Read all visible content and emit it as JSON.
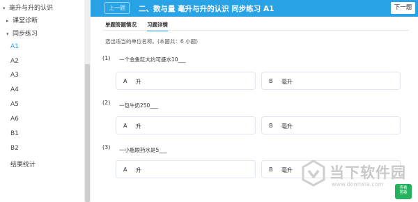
{
  "sidebar": {
    "items": [
      {
        "label": "毫升与升的认识",
        "caret": "▾"
      },
      {
        "label": "课堂诊断",
        "caret": "▸"
      },
      {
        "label": "同步练习",
        "caret": "▾"
      },
      {
        "label": "A1",
        "active": true
      },
      {
        "label": "A2"
      },
      {
        "label": "A3"
      },
      {
        "label": "A4"
      },
      {
        "label": "A5"
      },
      {
        "label": "A6"
      },
      {
        "label": "B1"
      },
      {
        "label": "B2"
      },
      {
        "label": "结果统计"
      }
    ]
  },
  "header": {
    "prev_label": "上一题",
    "title": "二、数与量 毫升与升的认识 同步练习 A1",
    "next_label": "下一题"
  },
  "tabs": [
    {
      "label": "单题答题情况",
      "active": false
    },
    {
      "label": "习题详情",
      "active": true
    }
  ],
  "instruction": "选出适当的单位名称。(本题共：6 小题)",
  "questions": [
    {
      "num": "(1)",
      "text": "一个金鱼缸大约可盛水10___",
      "options": [
        {
          "letter": "A",
          "text": "升"
        },
        {
          "letter": "B",
          "text": "毫升"
        }
      ]
    },
    {
      "num": "(2)",
      "text": "一包牛奶250___",
      "options": [
        {
          "letter": "A",
          "text": "升"
        },
        {
          "letter": "B",
          "text": "毫升"
        }
      ]
    },
    {
      "num": "(3)",
      "text": "一小瓶眼药水是5___",
      "options": [
        {
          "letter": "A",
          "text": "升"
        },
        {
          "letter": "B",
          "text": "毫升"
        }
      ]
    }
  ],
  "check_answer": {
    "line1": "查看",
    "line2": "答案"
  },
  "watermark": {
    "name": "当下软件园",
    "url": "www.downxia.com"
  },
  "colors": {
    "accent": "#2aa3e6",
    "check": "#25b15e"
  }
}
